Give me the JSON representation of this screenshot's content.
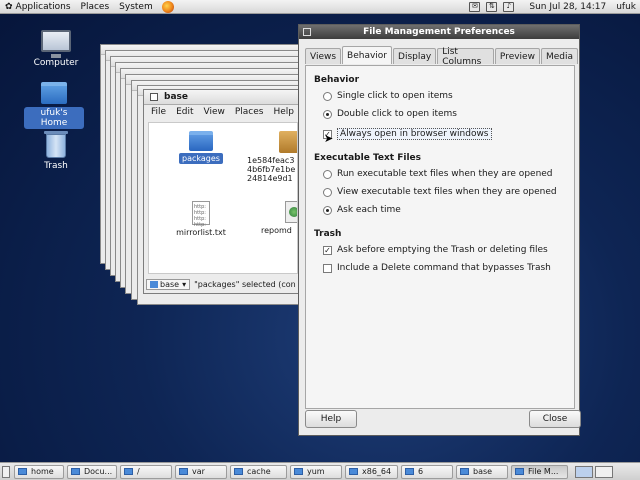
{
  "top_panel": {
    "applications": "Applications",
    "places": "Places",
    "system": "System",
    "clock": "Sun Jul 28, 14:17",
    "user": "ufuk"
  },
  "desktop": {
    "computer": "Computer",
    "home": "ufuk's Home",
    "trash": "Trash"
  },
  "file_manager": {
    "title": "base",
    "menus": [
      "File",
      "Edit",
      "View",
      "Places",
      "Help"
    ],
    "files": {
      "packages": "packages",
      "hash_line1": "1e584feac3",
      "hash_line2": "4b6fb7e1be",
      "hash_line3": "24814e9d1",
      "mirrorlist": "mirrorlist.txt",
      "repomd": "repomd",
      "txt_icon_lines": "http:\nhttp:\nhttp:\nhttp:"
    },
    "status": {
      "combo": "base",
      "text": "\"packages\" selected (con"
    }
  },
  "preferences": {
    "title": "File Management Preferences",
    "tabs": [
      "Views",
      "Behavior",
      "Display",
      "List Columns",
      "Preview",
      "Media"
    ],
    "active_tab": "Behavior",
    "behavior": {
      "heading": "Behavior",
      "single_click": "Single click to open items",
      "double_click": "Double click to open items",
      "browser_windows": "Always open in browser windows"
    },
    "executable": {
      "heading": "Executable Text Files",
      "run": "Run executable text files when they are opened",
      "view": "View executable text files when they are opened",
      "ask": "Ask each time"
    },
    "trash": {
      "heading": "Trash",
      "ask_before": "Ask before emptying the Trash or deleting files",
      "include_delete": "Include a Delete command that bypasses Trash"
    },
    "help_button": "Help",
    "close_button": "Close"
  },
  "taskbar": {
    "items": [
      "home",
      "Docu...",
      "/",
      "var",
      "cache",
      "yum",
      "x86_64",
      "6",
      "base",
      "File M..."
    ]
  }
}
